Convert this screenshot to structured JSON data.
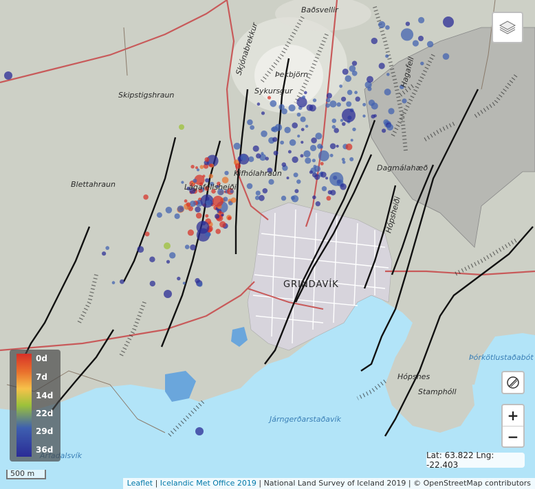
{
  "map": {
    "place_labels": [
      {
        "id": "badsvellir",
        "text": "Baðsvellir"
      },
      {
        "id": "skjonabrekkur",
        "text": "Skjónabrekkur"
      },
      {
        "id": "thekbjorn",
        "text": "Þekbjörn"
      },
      {
        "id": "sykursgur",
        "text": "Sykursgur"
      },
      {
        "id": "skipstigshraun",
        "text": "Skipstigshraun"
      },
      {
        "id": "blettahraun",
        "text": "Blettahraun"
      },
      {
        "id": "lagafellsheidi",
        "text": "Lágafellsheiði"
      },
      {
        "id": "kifholahraun",
        "text": "Kifhólahraun"
      },
      {
        "id": "dagmalahaed",
        "text": "Dagmálahæð"
      },
      {
        "id": "hopsheidi",
        "text": "Hópsheiði"
      },
      {
        "id": "hagafell",
        "text": "Hagafell"
      },
      {
        "id": "grindavik",
        "text": "GRINDAVÍK"
      },
      {
        "id": "hopsnes",
        "text": "Hópsnes"
      },
      {
        "id": "stampholl",
        "text": "Stamphóll"
      },
      {
        "id": "thorkotlustadabot",
        "text": "Þórkötlustaðabót"
      },
      {
        "id": "jarngerdarstadavik",
        "text": "Járngerðarstaðavík"
      },
      {
        "id": "arfadalsvik",
        "text": "Arfadalsvík"
      }
    ],
    "earthquake_age_color_scale": [
      "#d73027",
      "#e9722d",
      "#f6c24a",
      "#9cc23a",
      "#3e5fb0",
      "#2a2c96"
    ],
    "earthquakes_count_shown": "hundreds"
  },
  "controls": {
    "layers_icon": "layers-icon",
    "draw_icon": "ruler-draw-icon",
    "zoom_in": "+",
    "zoom_out": "−"
  },
  "coordinates": "Lat: 63.822 Lng: -22.403",
  "legend": {
    "ticks": [
      "0d",
      "7d",
      "14d",
      "22d",
      "29d",
      "36d"
    ]
  },
  "scale_bar": "500 m",
  "attribution": {
    "leaflet": "Leaflet",
    "sep1": " | ",
    "imo": "Icelandic Met Office 2019",
    "rest": " | National Land Survey of Iceland 2019 | © OpenStreetMap contributors"
  }
}
